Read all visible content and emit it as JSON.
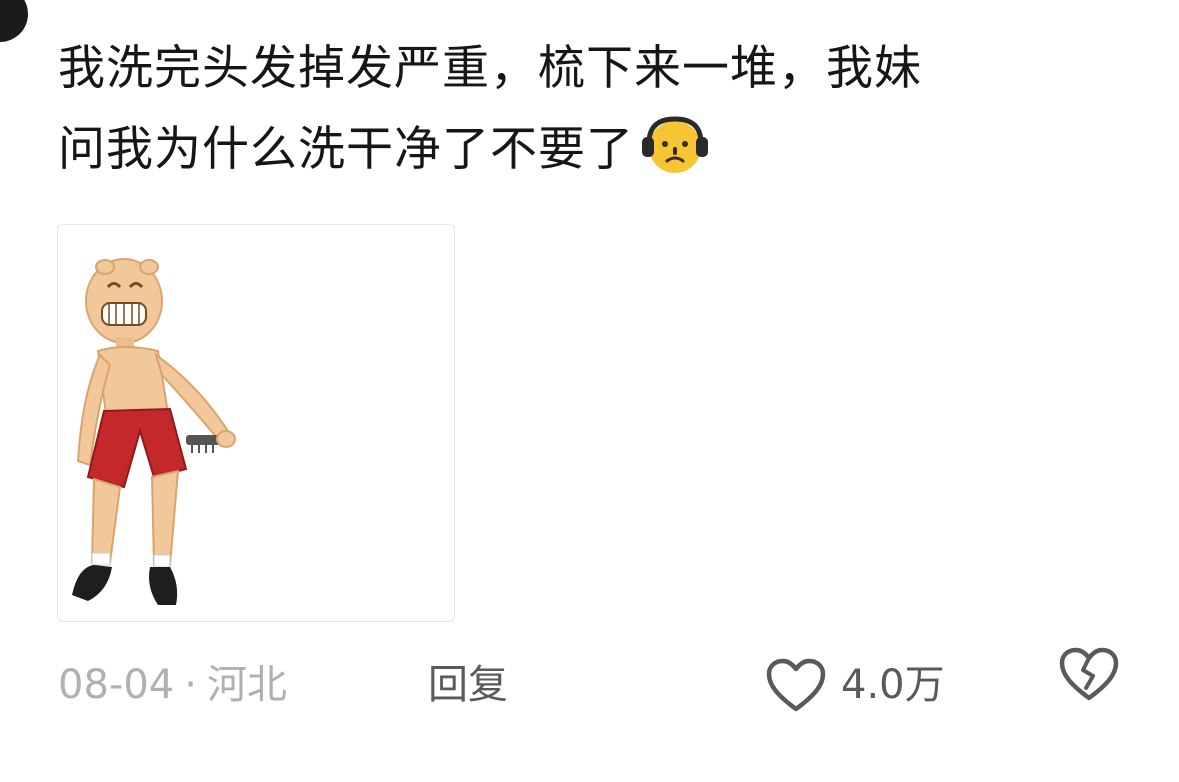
{
  "comment": {
    "line1": "我洗完头发掉发严重，梳下来一堆，我妹",
    "line2": "问我为什么洗干净了不要了",
    "inline_emoji": "headphones-sad-face-emoji",
    "attached_image": "laughing-cartoon-man-with-comb-sticker"
  },
  "footer": {
    "date": "08-04",
    "separator": "·",
    "location": "河北",
    "reply_label": "回复",
    "like_count": "4.0万",
    "like_icon": "heart-outline-icon",
    "dislike_icon": "broken-heart-icon"
  },
  "colors": {
    "text": "#161616",
    "meta": "#b0b0b0",
    "action": "#5a5a5a"
  }
}
